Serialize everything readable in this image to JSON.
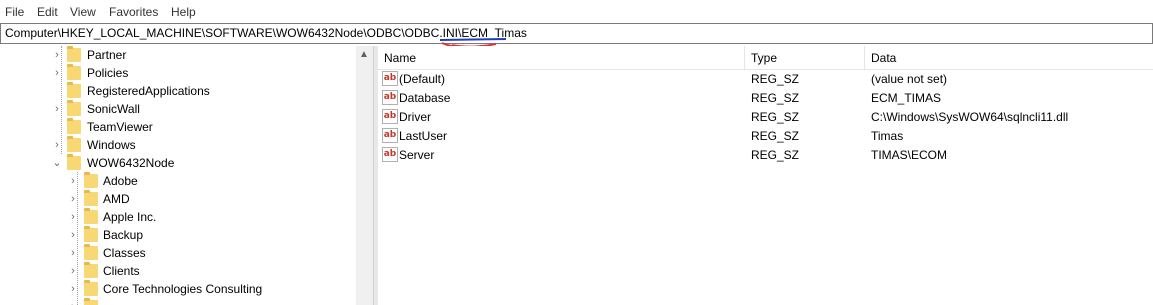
{
  "menu": [
    "File",
    "Edit",
    "View",
    "Favorites",
    "Help"
  ],
  "address": "Computer\\HKEY_LOCAL_MACHINE\\SOFTWARE\\WOW6432Node\\ODBC\\ODBC.INI\\ECM_Timas",
  "tree": {
    "items": [
      {
        "label": "Partner",
        "icon": "folder-icon"
      },
      {
        "label": "Policies",
        "icon": "folder-icon"
      },
      {
        "label": "RegisteredApplications",
        "icon": "folder-icon"
      },
      {
        "label": "SonicWall",
        "icon": "folder-icon"
      },
      {
        "label": "TeamViewer",
        "icon": "folder-icon"
      },
      {
        "label": "Windows",
        "icon": "folder-icon"
      },
      {
        "label": "WOW6432Node",
        "icon": "folder-icon",
        "expanded": true
      },
      {
        "label": "Adobe",
        "icon": "folder-icon"
      },
      {
        "label": "AMD",
        "icon": "folder-icon"
      },
      {
        "label": "Apple Inc.",
        "icon": "folder-icon"
      },
      {
        "label": "Backup",
        "icon": "folder-icon"
      },
      {
        "label": "Classes",
        "icon": "folder-icon"
      },
      {
        "label": "Clients",
        "icon": "folder-icon"
      },
      {
        "label": "Core Technologies Consulting",
        "icon": "folder-icon"
      }
    ]
  },
  "list": {
    "columns": [
      "Name",
      "Type",
      "Data"
    ],
    "rows": [
      {
        "name": "(Default)",
        "type": "REG_SZ",
        "data": "(value not set)"
      },
      {
        "name": "Database",
        "type": "REG_SZ",
        "data": "ECM_TIMAS"
      },
      {
        "name": "Driver",
        "type": "REG_SZ",
        "data": "C:\\Windows\\SysWOW64\\sqlncli11.dll"
      },
      {
        "name": "LastUser",
        "type": "REG_SZ",
        "data": "Timas"
      },
      {
        "name": "Server",
        "type": "REG_SZ",
        "data": "TIMAS\\ECOM"
      }
    ],
    "value_icon_text": "ab"
  }
}
